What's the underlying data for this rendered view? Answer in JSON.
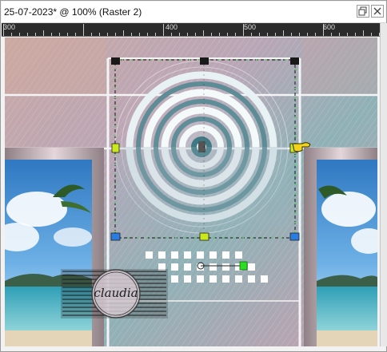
{
  "window": {
    "title": "25-07-2023* @ 100% (Raster 2)"
  },
  "ruler": {
    "labels": [
      "300",
      "400",
      "500",
      "600"
    ]
  },
  "watermark": {
    "text": "claudia"
  },
  "colors": {
    "ruler_bg": "#2b2b2b",
    "canvas_mauve": "#b8a2b0",
    "canvas_teal": "#8ab0b4",
    "sky_blue": "#3b86c8",
    "sea_turquoise": "#35a8bc",
    "selection_handle": "#1a1a1a",
    "node_green": "#29e01f"
  },
  "icons": {
    "cursor": "pointing-hand-icon"
  }
}
